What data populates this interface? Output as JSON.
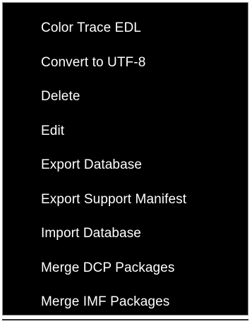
{
  "context_menu": {
    "items": [
      {
        "label": "Color Trace EDL"
      },
      {
        "label": "Convert to UTF-8"
      },
      {
        "label": "Delete"
      },
      {
        "label": "Edit"
      },
      {
        "label": "Export Database"
      },
      {
        "label": "Export Support Manifest"
      },
      {
        "label": "Import Database"
      },
      {
        "label": "Merge DCP Packages"
      },
      {
        "label": "Merge IMF Packages"
      }
    ]
  },
  "colors": {
    "menu_background": "#000000",
    "menu_text": "#ffffff",
    "menu_border": "#8a8a8a"
  }
}
